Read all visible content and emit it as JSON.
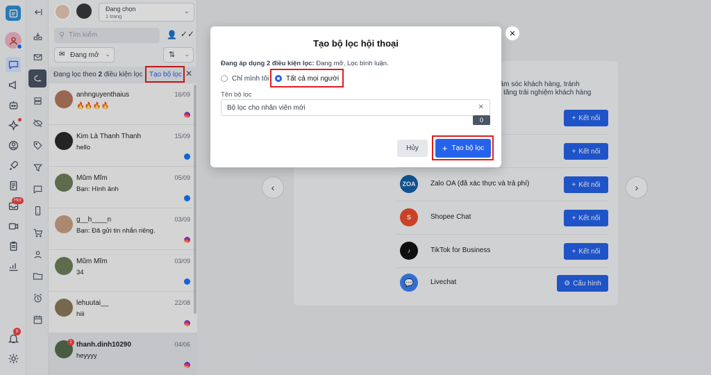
{
  "page_selector": {
    "label": "Đang chọn",
    "count": "1 trang"
  },
  "search": {
    "placeholder": "Tìm kiếm"
  },
  "status_filter": {
    "value": "Đang mở"
  },
  "filter_bar": {
    "text_pre": "Đang lọc theo ",
    "count": "2",
    "text_post": " điều kiện lọc",
    "create_link": "Tạo bộ lọc"
  },
  "hot_badge": "Hot",
  "notif_count": "8",
  "conversations": [
    {
      "name": "anhnguyenthaius",
      "date": "16/09",
      "message": "🔥🔥🔥🔥",
      "channel": "instagram",
      "avatar_color": "#b47a5c"
    },
    {
      "name": "Kim Là Thanh Thanh",
      "date": "15/09",
      "message": "hello",
      "channel": "facebook",
      "avatar_color": "#2b2b2b"
    },
    {
      "name": "Mũm Mĩm",
      "date": "05/09",
      "message": "Bạn: Hình ảnh",
      "channel": "facebook",
      "avatar_color": "#6d7f5a"
    },
    {
      "name": "g__h____n",
      "date": "03/09",
      "message": "Bạn: Đã gửi tin nhắn riêng.",
      "channel": "instagram",
      "avatar_color": "#c9a184"
    },
    {
      "name": "Mũm Mĩm",
      "date": "03/09",
      "message": "34",
      "channel": "facebook",
      "avatar_color": "#6d7f5a"
    },
    {
      "name": "lehuutai__",
      "date": "22/08",
      "message": "hiii",
      "channel": "instagram",
      "avatar_color": "#8b7b5a"
    },
    {
      "name": "thanh.dinh10290",
      "date": "04/06",
      "message": "heyyyy",
      "channel": "instagram",
      "avatar_color": "#556b4f",
      "unread": "1"
    }
  ],
  "background": {
    "desc_line1": "chăm sóc khách hàng, tránh",
    "desc_line2": "gia tăng trải nghiệm khách hàng",
    "platforms": [
      {
        "name": "",
        "button": "Kết nối"
      },
      {
        "name": "",
        "button": "Kết nối"
      },
      {
        "name": "Zalo OA (đã xác thực và trả phí)",
        "button": "Kết nối",
        "icon_text": "ZOA"
      },
      {
        "name": "Shopee Chat",
        "button": "Kết nối",
        "icon_text": "S"
      },
      {
        "name": "TikTok for Business",
        "button": "Kết nối",
        "icon_text": "♪"
      },
      {
        "name": "Livechat",
        "button": "Cấu hình",
        "icon_text": "💬"
      }
    ]
  },
  "modal": {
    "title": "Tạo bộ lọc hội thoại",
    "applied_label": "Đang áp dụng 2 điều kiện lọc:",
    "applied_value": " Đang mở, Lọc bình luận.",
    "options": [
      "Chỉ mình tôi",
      "Tất cả mọi người"
    ],
    "selected_option": "Tất cả mọi người",
    "name_label": "Tên bộ lọc",
    "name_value": "Bộ lọc cho nhân viên mới",
    "char_count": "0",
    "cancel": "Hủy",
    "submit": "Tạo bộ lọc"
  },
  "colors": {
    "accent": "#2563eb",
    "highlight": "#e11d1d"
  }
}
